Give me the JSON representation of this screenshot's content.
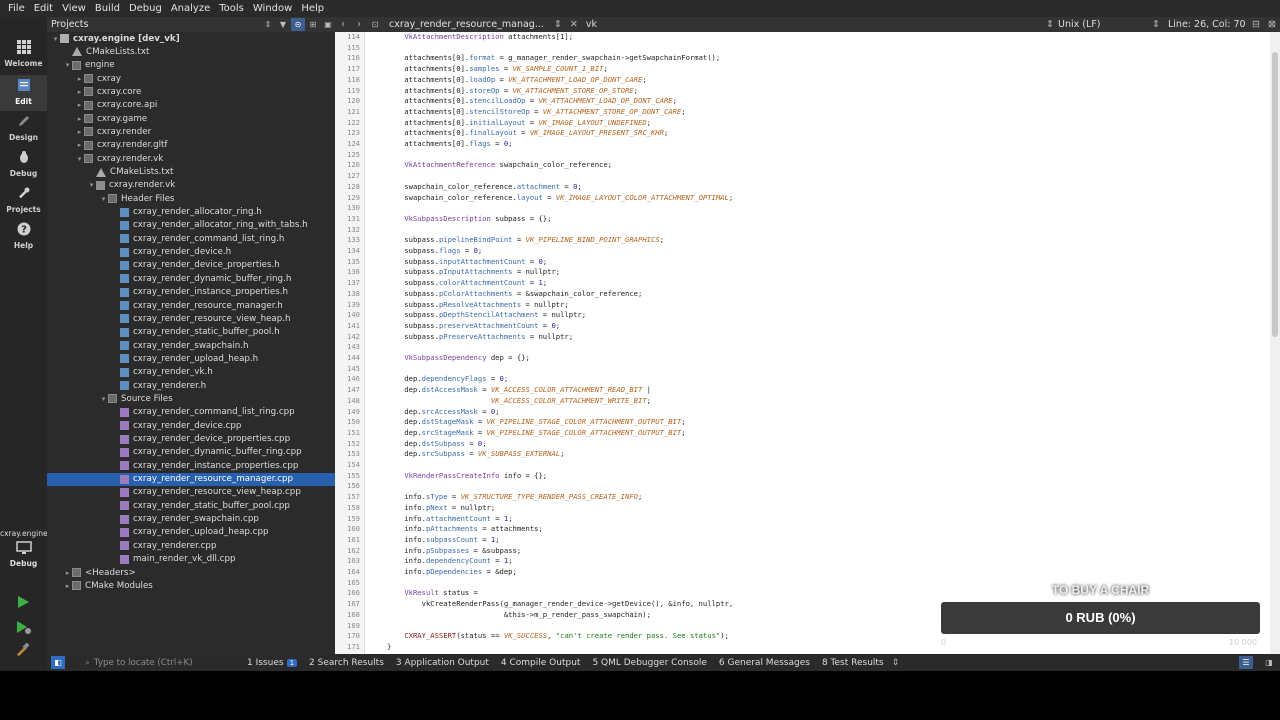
{
  "menu": [
    "File",
    "Edit",
    "View",
    "Build",
    "Debug",
    "Analyze",
    "Tools",
    "Window",
    "Help"
  ],
  "modes": [
    {
      "label": "Welcome",
      "icon": "grid-icon"
    },
    {
      "label": "Edit",
      "icon": "document-icon"
    },
    {
      "label": "Design",
      "icon": "pencil-icon"
    },
    {
      "label": "Debug",
      "icon": "bug-icon"
    },
    {
      "label": "Projects",
      "icon": "wrench-icon"
    },
    {
      "label": "Help",
      "icon": "help-icon"
    }
  ],
  "kit": {
    "project": "cxray.engine",
    "label": "Debug"
  },
  "projects": {
    "title": "Projects",
    "tree": [
      {
        "text": "cxray.engine [dev_vk]",
        "indent": 0,
        "arrow": "▾",
        "icon": "proj",
        "bold": true
      },
      {
        "text": "CMakeLists.txt",
        "indent": 1,
        "arrow": "",
        "icon": "cmake"
      },
      {
        "text": "engine",
        "indent": 1,
        "arrow": "▾",
        "icon": "folder"
      },
      {
        "text": "cxray",
        "indent": 2,
        "arrow": "▸",
        "icon": "folder"
      },
      {
        "text": "cxray.core",
        "indent": 2,
        "arrow": "▸",
        "icon": "folder"
      },
      {
        "text": "cxray.core.api",
        "indent": 2,
        "arrow": "▸",
        "icon": "folder"
      },
      {
        "text": "cxray.game",
        "indent": 2,
        "arrow": "▸",
        "icon": "folder"
      },
      {
        "text": "cxray.render",
        "indent": 2,
        "arrow": "▸",
        "icon": "folder"
      },
      {
        "text": "cxray.render.gltf",
        "indent": 2,
        "arrow": "▸",
        "icon": "folder"
      },
      {
        "text": "cxray.render.vk",
        "indent": 2,
        "arrow": "▾",
        "icon": "folder"
      },
      {
        "text": "CMakeLists.txt",
        "indent": 3,
        "arrow": "",
        "icon": "cmake"
      },
      {
        "text": "cxray.render.vk",
        "indent": 3,
        "arrow": "▾",
        "icon": "file"
      },
      {
        "text": "Header Files",
        "indent": 4,
        "arrow": "▾",
        "icon": "folder"
      },
      {
        "text": "cxray_render_allocator_ring.h",
        "indent": 5,
        "arrow": "",
        "icon": "h"
      },
      {
        "text": "cxray_render_allocator_ring_with_tabs.h",
        "indent": 5,
        "arrow": "",
        "icon": "h"
      },
      {
        "text": "cxray_render_command_list_ring.h",
        "indent": 5,
        "arrow": "",
        "icon": "h"
      },
      {
        "text": "cxray_render_device.h",
        "indent": 5,
        "arrow": "",
        "icon": "h"
      },
      {
        "text": "cxray_render_device_properties.h",
        "indent": 5,
        "arrow": "",
        "icon": "h"
      },
      {
        "text": "cxray_render_dynamic_buffer_ring.h",
        "indent": 5,
        "arrow": "",
        "icon": "h"
      },
      {
        "text": "cxray_render_instance_properties.h",
        "indent": 5,
        "arrow": "",
        "icon": "h"
      },
      {
        "text": "cxray_render_resource_manager.h",
        "indent": 5,
        "arrow": "",
        "icon": "h"
      },
      {
        "text": "cxray_render_resource_view_heap.h",
        "indent": 5,
        "arrow": "",
        "icon": "h"
      },
      {
        "text": "cxray_render_static_buffer_pool.h",
        "indent": 5,
        "arrow": "",
        "icon": "h"
      },
      {
        "text": "cxray_render_swapchain.h",
        "indent": 5,
        "arrow": "",
        "icon": "h"
      },
      {
        "text": "cxray_render_upload_heap.h",
        "indent": 5,
        "arrow": "",
        "icon": "h"
      },
      {
        "text": "cxray_render_vk.h",
        "indent": 5,
        "arrow": "",
        "icon": "h"
      },
      {
        "text": "cxray_renderer.h",
        "indent": 5,
        "arrow": "",
        "icon": "h"
      },
      {
        "text": "Source Files",
        "indent": 4,
        "arrow": "▾",
        "icon": "folder"
      },
      {
        "text": "cxray_render_command_list_ring.cpp",
        "indent": 5,
        "arrow": "",
        "icon": "cpp"
      },
      {
        "text": "cxray_render_device.cpp",
        "indent": 5,
        "arrow": "",
        "icon": "cpp"
      },
      {
        "text": "cxray_render_device_properties.cpp",
        "indent": 5,
        "arrow": "",
        "icon": "cpp"
      },
      {
        "text": "cxray_render_dynamic_buffer_ring.cpp",
        "indent": 5,
        "arrow": "",
        "icon": "cpp"
      },
      {
        "text": "cxray_render_instance_properties.cpp",
        "indent": 5,
        "arrow": "",
        "icon": "cpp"
      },
      {
        "text": "cxray_render_resource_manager.cpp",
        "indent": 5,
        "arrow": "",
        "icon": "cpp",
        "selected": true
      },
      {
        "text": "cxray_render_resource_view_heap.cpp",
        "indent": 5,
        "arrow": "",
        "icon": "cpp"
      },
      {
        "text": "cxray_render_static_buffer_pool.cpp",
        "indent": 5,
        "arrow": "",
        "icon": "cpp"
      },
      {
        "text": "cxray_render_swapchain.cpp",
        "indent": 5,
        "arrow": "",
        "icon": "cpp"
      },
      {
        "text": "cxray_render_upload_heap.cpp",
        "indent": 5,
        "arrow": "",
        "icon": "cpp"
      },
      {
        "text": "cxray_renderer.cpp",
        "indent": 5,
        "arrow": "",
        "icon": "cpp"
      },
      {
        "text": "main_render_vk_dll.cpp",
        "indent": 5,
        "arrow": "",
        "icon": "cpp"
      },
      {
        "text": "<Headers>",
        "indent": 1,
        "arrow": "▸",
        "icon": "folder"
      },
      {
        "text": "CMake Modules",
        "indent": 1,
        "arrow": "▸",
        "icon": "folder"
      }
    ]
  },
  "editor": {
    "file_tab": "cxray_render_resource_manag...",
    "symbol": "vk",
    "line_ending": "Unix (LF)",
    "cursor": "Line: 26, Col: 70",
    "first_line": 114,
    "lines": [
      "    VkAttachmentDescription attachments[1];",
      "",
      "    attachments[0].format = g_manager_render_swapchain->getSwapchainFormat();",
      "    attachments[0].samples = VK_SAMPLE_COUNT_1_BIT;",
      "    attachments[0].loadOp = VK_ATTACHMENT_LOAD_OP_DONT_CARE;",
      "    attachments[0].storeOp = VK_ATTACHMENT_STORE_OP_STORE;",
      "    attachments[0].stencilLoadOp = VK_ATTACHMENT_LOAD_OP_DONT_CARE;",
      "    attachments[0].stencilStoreOp = VK_ATTACHMENT_STORE_OP_DONT_CARE;",
      "    attachments[0].initialLayout = VK_IMAGE_LAYOUT_UNDEFINED;",
      "    attachments[0].finalLayout = VK_IMAGE_LAYOUT_PRESENT_SRC_KHR;",
      "    attachments[0].flags = 0;",
      "",
      "    VkAttachmentReference swapchain_color_reference;",
      "",
      "    swapchain_color_reference.attachment = 0;",
      "    swapchain_color_reference.layout = VK_IMAGE_LAYOUT_COLOR_ATTACHMENT_OPTIMAL;",
      "",
      "    VkSubpassDescription subpass = {};",
      "",
      "    subpass.pipelineBindPoint = VK_PIPELINE_BIND_POINT_GRAPHICS;",
      "    subpass.flags = 0;",
      "    subpass.inputAttachmentCount = 0;",
      "    subpass.pInputAttachments = nullptr;",
      "    subpass.colorAttachmentCount = 1;",
      "    subpass.pColorAttachments = &swapchain_color_reference;",
      "    subpass.pResolveAttachments = nullptr;",
      "    subpass.pDepthStencilAttachment = nullptr;",
      "    subpass.preserveAttachmentCount = 0;",
      "    subpass.pPreserveAttachments = nullptr;",
      "",
      "    VkSubpassDependency dep = {};",
      "",
      "    dep.dependencyFlags = 0;",
      "    dep.dstAccessMask = VK_ACCESS_COLOR_ATTACHMENT_READ_BIT |",
      "                        VK_ACCESS_COLOR_ATTACHMENT_WRITE_BIT;",
      "    dep.srcAccessMask = 0;",
      "    dep.dstStageMask = VK_PIPELINE_STAGE_COLOR_ATTACHMENT_OUTPUT_BIT;",
      "    dep.srcStageMask = VK_PIPELINE_STAGE_COLOR_ATTACHMENT_OUTPUT_BIT;",
      "    dep.dstSubpass = 0;",
      "    dep.srcSubpass = VK_SUBPASS_EXTERNAL;",
      "",
      "    VkRenderPassCreateInfo info = {};",
      "",
      "    info.sType = VK_STRUCTURE_TYPE_RENDER_PASS_CREATE_INFO;",
      "    info.pNext = nullptr;",
      "    info.attachmentCount = 1;",
      "    info.pAttachments = attachments;",
      "    info.subpassCount = 1;",
      "    info.pSubpasses = &subpass;",
      "    info.dependencyCount = 1;",
      "    info.pDependencies = &dep;",
      "",
      "    VkResult status =",
      "        vkCreateRenderPass(g_manager_render_device->getDevice(), &info, nullptr,",
      "                           &this->m_p_render_pass_swapchain);",
      "",
      "    CXRAY_ASSERT(status == VK_SUCCESS, \"can't create render pass. See status\");",
      "}"
    ]
  },
  "statusbar": {
    "locate_placeholder": "Type to locate (Ctrl+K)",
    "tabs": [
      {
        "label": "1  Issues",
        "badge": "1"
      },
      {
        "label": "2  Search Results"
      },
      {
        "label": "3  Application Output"
      },
      {
        "label": "4  Compile Output"
      },
      {
        "label": "5  QML Debugger Console"
      },
      {
        "label": "6  General Messages"
      },
      {
        "label": "8  Test Results"
      }
    ]
  },
  "donation": {
    "title": "TO BUY A CHAIR",
    "amount_text": "0 RUB (0%)",
    "progress": 0,
    "min": "0",
    "max": "10 000",
    "fill_color": "#2d8e3f"
  }
}
